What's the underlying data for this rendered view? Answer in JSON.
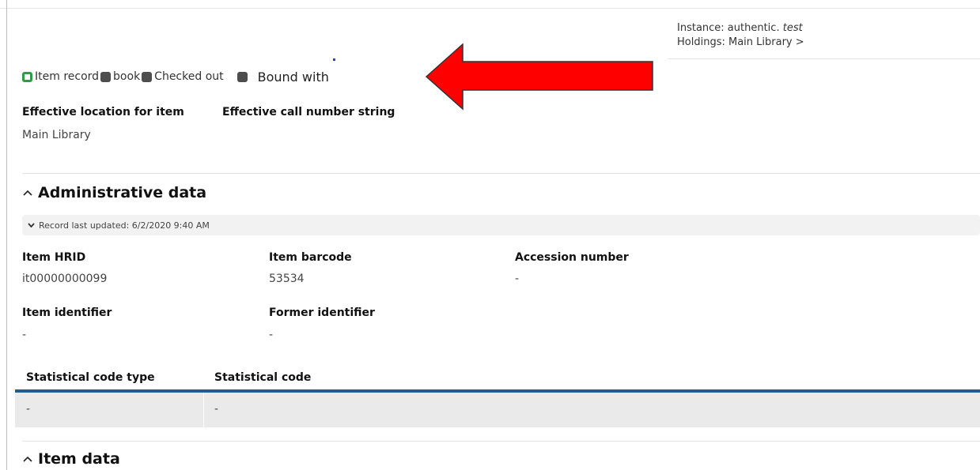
{
  "header": {
    "instance_prefix": "Instance: authentic. ",
    "instance_emph": "test",
    "holdings": "Holdings: Main Library >"
  },
  "tags": {
    "item_record": "Item record",
    "book": "book",
    "checked_out": "Checked out",
    "bound_with": "Bound with"
  },
  "location": {
    "effective_location_label": "Effective location for item",
    "effective_location_value": "Main Library",
    "call_number_label": "Effective call number string"
  },
  "admin": {
    "title": "Administrative data",
    "record_updated": "Record last updated: 6/2/2020 9:40 AM",
    "item_hrid_label": "Item HRID",
    "item_hrid_value": "it00000000099",
    "item_barcode_label": "Item barcode",
    "item_barcode_value": "53534",
    "accession_label": "Accession number",
    "accession_value": "-",
    "item_identifier_label": "Item identifier",
    "item_identifier_value": "-",
    "former_identifier_label": "Former identifier",
    "former_identifier_value": "-"
  },
  "stat_table": {
    "columns": [
      "Statistical code type",
      "Statistical code"
    ],
    "rows": [
      [
        "-",
        "-"
      ]
    ]
  },
  "item_data": {
    "title": "Item data"
  },
  "colors": {
    "accent_blue": "#1f5c98",
    "status_green": "#2e9c46",
    "annotation_red": "#ff0000"
  },
  "icons": {
    "item_record": "green-square-icon",
    "status": "dark-square-icon",
    "section_toggle": "caret-up-icon",
    "record_toggle": "chevron-down-icon",
    "annotation": "red-arrow-left"
  }
}
